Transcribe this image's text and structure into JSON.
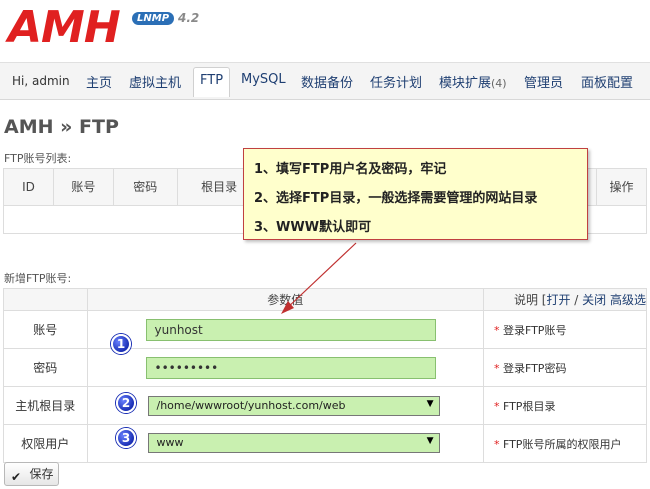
{
  "logo": {
    "text": "AMH",
    "badge": "LNMP",
    "version": "4.2"
  },
  "nav": {
    "greeting": "Hi, admin",
    "items": [
      {
        "label": "主页"
      },
      {
        "label": "虚拟主机"
      },
      {
        "label": "FTP"
      },
      {
        "label": "MySQL"
      },
      {
        "label": "数据备份"
      },
      {
        "label": "任务计划"
      },
      {
        "label": "模块扩展",
        "count": "(4)"
      },
      {
        "label": "管理员"
      },
      {
        "label": "面板配置"
      }
    ]
  },
  "page": {
    "title": "AMH » FTP"
  },
  "ftp_list": {
    "label": "FTP账号列表:",
    "columns": [
      "ID",
      "账号",
      "密码",
      "根目录",
      "操作"
    ]
  },
  "note": {
    "lines": [
      "1、填写FTP用户名及密码，牢记",
      "2、选择FTP目录，一般选择需要管理的网站目录",
      "3、WWW默认即可"
    ]
  },
  "add_form": {
    "label": "新增FTP账号:",
    "header_value": "参数值",
    "header_desc_prefix": "说明 [",
    "header_open": "打开",
    "header_sep": " / ",
    "header_close": "关闭",
    "header_adv": " 高级选",
    "rows": [
      {
        "label": "账号",
        "value": "yunhost",
        "desc": "登录FTP账号"
      },
      {
        "label": "密码",
        "value": "•••••••••",
        "desc": "登录FTP密码"
      },
      {
        "label": "主机根目录",
        "value": "/home/wwwroot/yunhost.com/web",
        "desc": "FTP根目录"
      },
      {
        "label": "权限用户",
        "value": "www",
        "desc": "FTP账号所属的权限用户"
      }
    ],
    "required_mark": "*",
    "markers": [
      "1",
      "2",
      "3"
    ]
  },
  "save": {
    "label": "保存",
    "icon": "✔"
  },
  "colors": {
    "accent_red": "#e02020",
    "field_green": "#c9f0b0",
    "note_bg": "#ffffcc",
    "marker_blue": "#1a2fb4"
  }
}
